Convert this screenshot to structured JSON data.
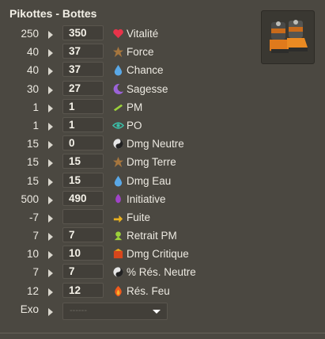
{
  "title": "Pikottes - Bottes",
  "item_image": "boots-item-icon",
  "rows": [
    {
      "base": "250",
      "value": "350",
      "icon": "heart-icon",
      "label": "Vitalité"
    },
    {
      "base": "40",
      "value": "37",
      "icon": "force-icon",
      "label": "Force"
    },
    {
      "base": "40",
      "value": "37",
      "icon": "water-drop-icon",
      "label": "Chance"
    },
    {
      "base": "30",
      "value": "27",
      "icon": "moon-icon",
      "label": "Sagesse"
    },
    {
      "base": "1",
      "value": "1",
      "icon": "pm-boot-icon",
      "label": "PM"
    },
    {
      "base": "1",
      "value": "1",
      "icon": "eye-icon",
      "label": "PO"
    },
    {
      "base": "15",
      "value": "0",
      "icon": "neutral-icon",
      "label": "Dmg Neutre"
    },
    {
      "base": "15",
      "value": "15",
      "icon": "earth-icon",
      "label": "Dmg Terre"
    },
    {
      "base": "15",
      "value": "15",
      "icon": "water-drop-icon",
      "label": "Dmg Eau"
    },
    {
      "base": "500",
      "value": "490",
      "icon": "initiative-icon",
      "label": "Initiative"
    },
    {
      "base": "-7",
      "value": "",
      "icon": "flee-icon",
      "label": "Fuite"
    },
    {
      "base": "7",
      "value": "7",
      "icon": "mp-removal-icon",
      "label": "Retrait PM"
    },
    {
      "base": "10",
      "value": "10",
      "icon": "critical-icon",
      "label": "Dmg Critique"
    },
    {
      "base": "7",
      "value": "7",
      "icon": "neutral-resist-icon",
      "label": "% Rés. Neutre"
    },
    {
      "base": "12",
      "value": "12",
      "icon": "fire-icon",
      "label": "Rés. Feu"
    }
  ],
  "exo": {
    "label": "Exo",
    "selected": "------"
  }
}
